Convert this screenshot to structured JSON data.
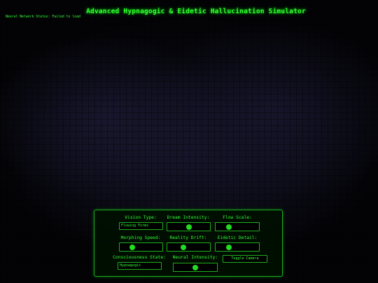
{
  "header": {
    "title": "Advanced Hypnagogic & Eidetic Hallucination Simulator",
    "status": "Neural Network Status: Failed to load"
  },
  "controls": {
    "vision_type": {
      "label": "Vision Type:",
      "value": "Flowing Forms"
    },
    "dream_intensity": {
      "label": "Dream Intensity:",
      "level": 0.5
    },
    "flow_scale": {
      "label": "Flow Scale:",
      "level": 0.25
    },
    "morphing_speed": {
      "label": "Morphing Speed:",
      "level": 0.25
    },
    "reality_drift": {
      "label": "Reality Drift:",
      "level": 0.35
    },
    "eidetic_detail": {
      "label": "Eidetic Detail:",
      "level": 0.25
    },
    "consciousness_state": {
      "label": "Consciousness State:",
      "value": "Hypnagogic"
    },
    "neural_intensity": {
      "label": "Neural Intensity:",
      "level": 0.5
    },
    "toggle_camera": {
      "label": "Toggle Camera"
    }
  },
  "colors": {
    "accent": "#33ff33",
    "background": "#000000"
  }
}
